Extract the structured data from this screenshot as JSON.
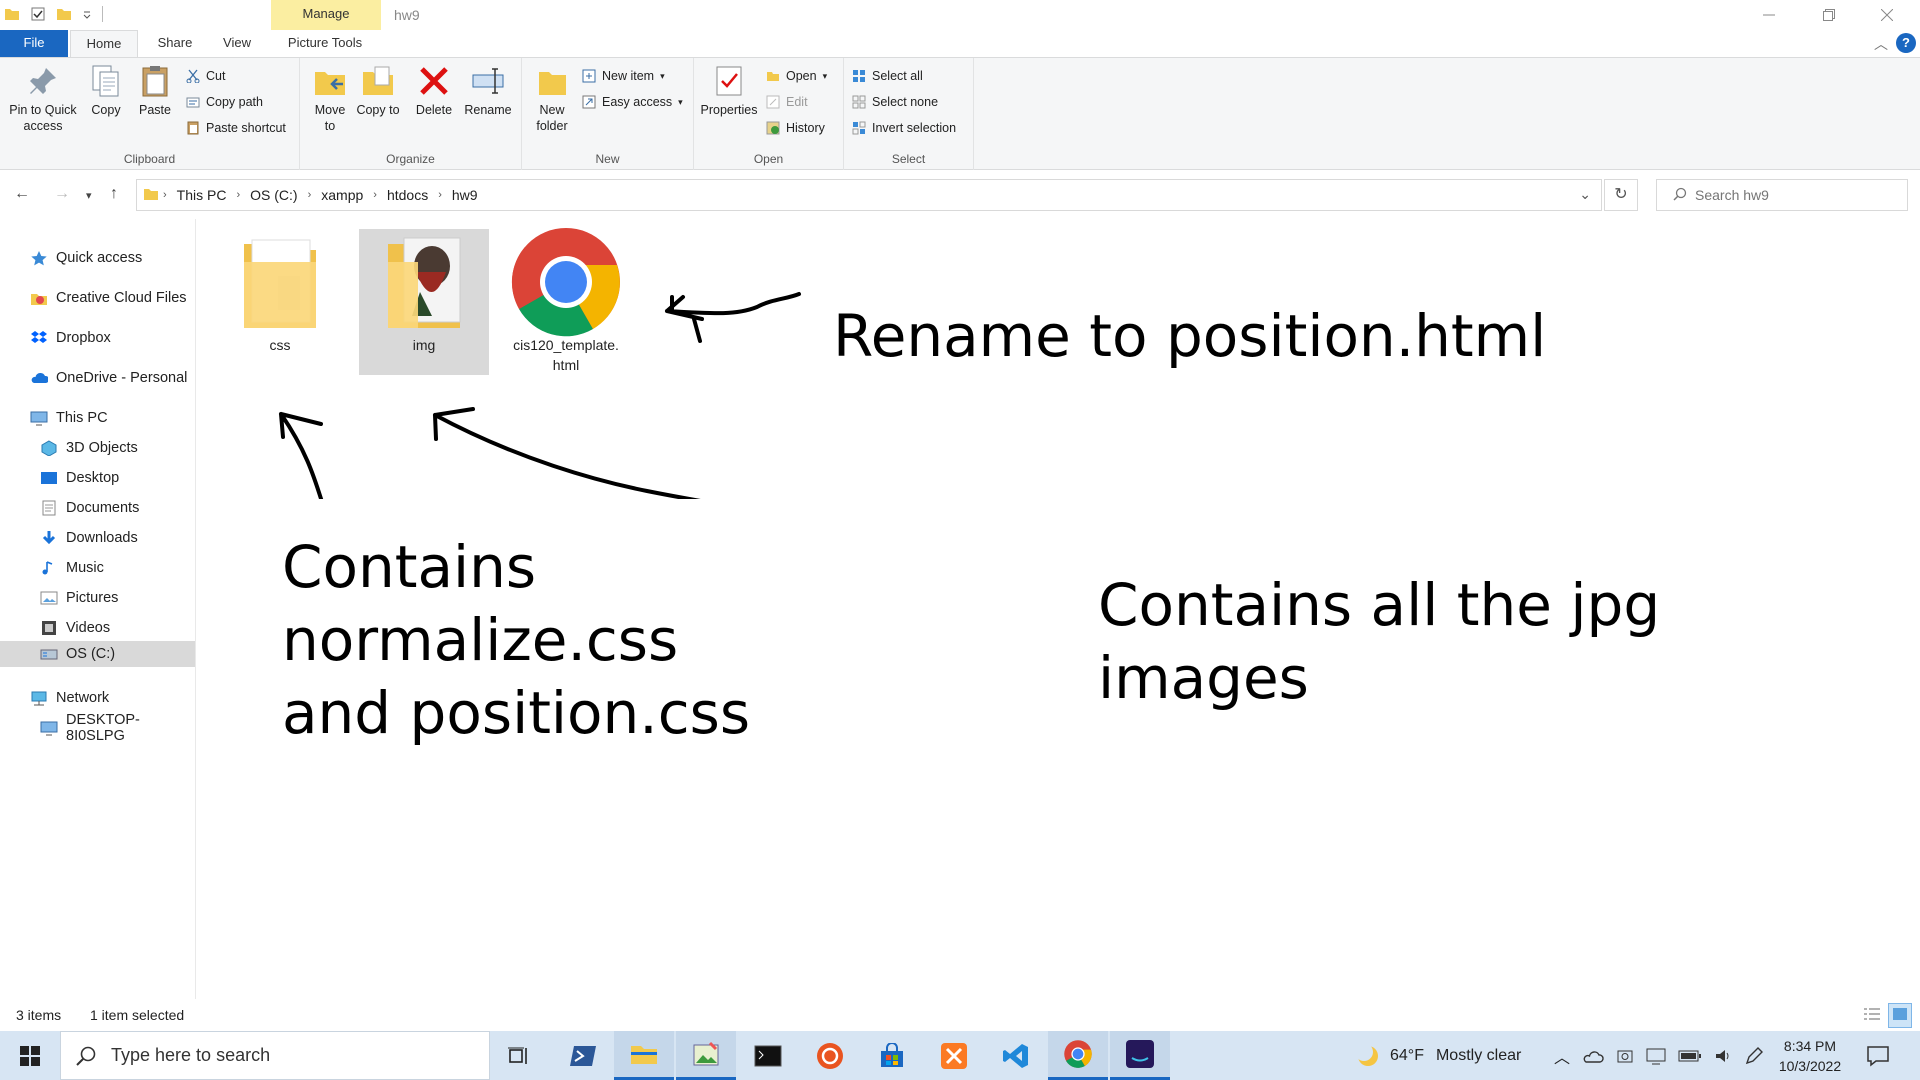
{
  "window": {
    "title": "hw9",
    "manage_tab": "Manage"
  },
  "tabs": {
    "file": "File",
    "home": "Home",
    "share": "Share",
    "view": "View",
    "picture_tools": "Picture Tools"
  },
  "ribbon": {
    "clipboard": {
      "label": "Clipboard",
      "pin": "Pin to Quick access",
      "copy": "Copy",
      "paste": "Paste",
      "cut": "Cut",
      "copy_path": "Copy path",
      "paste_shortcut": "Paste shortcut"
    },
    "organize": {
      "label": "Organize",
      "move_to": "Move to",
      "copy_to": "Copy to",
      "delete": "Delete",
      "rename": "Rename"
    },
    "new": {
      "label": "New",
      "new_folder": "New folder",
      "new_item": "New item",
      "easy_access": "Easy access"
    },
    "open": {
      "label": "Open",
      "properties": "Properties",
      "open": "Open",
      "edit": "Edit",
      "history": "History"
    },
    "select": {
      "label": "Select",
      "select_all": "Select all",
      "select_none": "Select none",
      "invert": "Invert selection"
    }
  },
  "address": {
    "crumbs": [
      "This PC",
      "OS (C:)",
      "xampp",
      "htdocs",
      "hw9"
    ],
    "search_placeholder": "Search hw9"
  },
  "nav": {
    "quick_access": "Quick access",
    "creative_cloud": "Creative Cloud Files",
    "dropbox": "Dropbox",
    "onedrive": "OneDrive - Personal",
    "this_pc": "This PC",
    "objects3d": "3D Objects",
    "desktop": "Desktop",
    "documents": "Documents",
    "downloads": "Downloads",
    "music": "Music",
    "pictures": "Pictures",
    "videos": "Videos",
    "os_c": "OS (C:)",
    "network": "Network",
    "desktop_pc": "DESKTOP-8I0SLPG"
  },
  "files": [
    {
      "name": "css"
    },
    {
      "name": "img"
    },
    {
      "name": "cis120_template.\nhtml"
    }
  ],
  "annotations": {
    "rename": "Rename to position.html",
    "css_line1": "Contains",
    "css_line2": "normalize.css",
    "css_line3": "and position.css",
    "img_line1": "Contains all the jpg",
    "img_line2": "images"
  },
  "status": {
    "items": "3 items",
    "selected": "1 item selected"
  },
  "taskbar": {
    "search_placeholder": "Type here to search",
    "weather_temp": "64°F",
    "weather_desc": "Mostly clear",
    "time": "8:34 PM",
    "date": "10/3/2022"
  },
  "colors": {
    "accent": "#1a67c1",
    "manage_tab": "#fbeea1",
    "selection": "#d9d9d9",
    "taskbar": "#d7e5f3"
  }
}
